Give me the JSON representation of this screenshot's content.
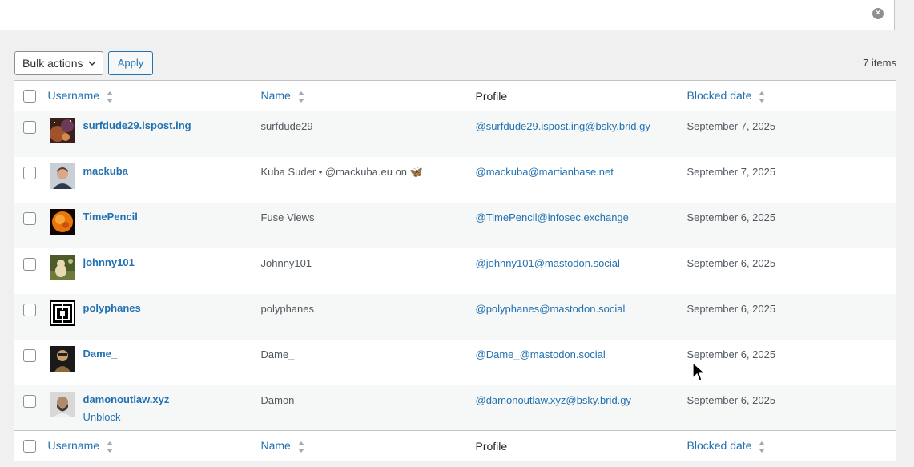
{
  "search": {
    "clear_icon": "×"
  },
  "tablenav": {
    "bulk_actions_label": "Bulk actions",
    "apply_label": "Apply",
    "items_count": "7 items"
  },
  "columns": {
    "username": "Username",
    "name": "Name",
    "profile": "Profile",
    "blocked_date": "Blocked date"
  },
  "rows": [
    {
      "username": "surfdude29.ispost.ing",
      "name": "surfdude29",
      "profile": "@surfdude29.ispost.ing@bsky.brid.gy",
      "date": "September 7, 2025",
      "avatar": "space-nebula"
    },
    {
      "username": "mackuba",
      "name": "Kuba Suder • @mackuba.eu on 🦋",
      "profile": "@mackuba@martianbase.net",
      "date": "September 7, 2025",
      "avatar": "person-photo"
    },
    {
      "username": "TimePencil",
      "name": "Fuse Views",
      "profile": "@TimePencil@infosec.exchange",
      "date": "September 6, 2025",
      "avatar": "sun"
    },
    {
      "username": "johnny101",
      "name": "Johnny101",
      "profile": "@johnny101@mastodon.social",
      "date": "September 6, 2025",
      "avatar": "cat-photo"
    },
    {
      "username": "polyphanes",
      "name": "polyphanes",
      "profile": "@polyphanes@mastodon.social",
      "date": "September 6, 2025",
      "avatar": "maze-logo"
    },
    {
      "username": "Dame_",
      "name": "Dame_",
      "profile": "@Dame_@mastodon.social",
      "date": "September 6, 2025",
      "avatar": "dame-photo"
    },
    {
      "username": "damonoutlaw.xyz",
      "name": "Damon ",
      "profile": "@damonoutlaw.xyz@bsky.brid.gy",
      "date": "September 6, 2025",
      "avatar": "bearded-person",
      "row_action": "Unblock"
    }
  ]
}
